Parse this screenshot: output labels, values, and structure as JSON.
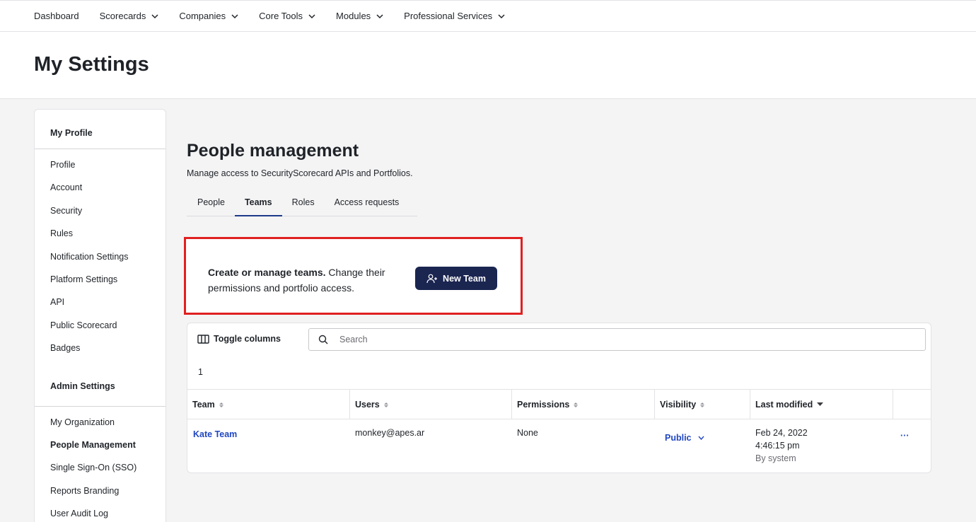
{
  "nav": {
    "items": [
      {
        "label": "Dashboard",
        "dropdown": false
      },
      {
        "label": "Scorecards",
        "dropdown": true
      },
      {
        "label": "Companies",
        "dropdown": true
      },
      {
        "label": "Core Tools",
        "dropdown": true
      },
      {
        "label": "Modules",
        "dropdown": true
      },
      {
        "label": "Professional Services",
        "dropdown": true
      }
    ]
  },
  "page": {
    "title": "My Settings"
  },
  "sidebar": {
    "section1": "My Profile",
    "items1": [
      "Profile",
      "Account",
      "Security",
      "Rules",
      "Notification Settings",
      "Platform Settings",
      "API",
      "Public Scorecard",
      "Badges"
    ],
    "section2": "Admin Settings",
    "items2": [
      "My Organization",
      "People Management",
      "Single Sign-On (SSO)",
      "Reports Branding",
      "User Audit Log"
    ],
    "active": "People Management"
  },
  "main": {
    "title": "People management",
    "subtitle": "Manage access to SecurityScorecard APIs and Portfolios.",
    "tabs": [
      "People",
      "Teams",
      "Roles",
      "Access requests"
    ],
    "active_tab": "Teams"
  },
  "callout": {
    "bold": "Create or manage teams.",
    "text": " Change their permissions and portfolio access.",
    "button": "New Team"
  },
  "table": {
    "toggle_label": "Toggle columns",
    "search_placeholder": "Search",
    "count": "1",
    "columns": [
      "Team",
      "Users",
      "Permissions",
      "Visibility",
      "Last modified"
    ],
    "rows": [
      {
        "team": "Kate Team",
        "users": "monkey@apes.ar",
        "permissions": "None",
        "visibility": "Public",
        "modified_date": "Feb 24, 2022",
        "modified_time": "4:46:15 pm",
        "modified_by": "By system",
        "more": "···"
      }
    ]
  },
  "colors": {
    "accent": "#1a2550",
    "link": "#2147c1",
    "highlight": "#e02020"
  }
}
